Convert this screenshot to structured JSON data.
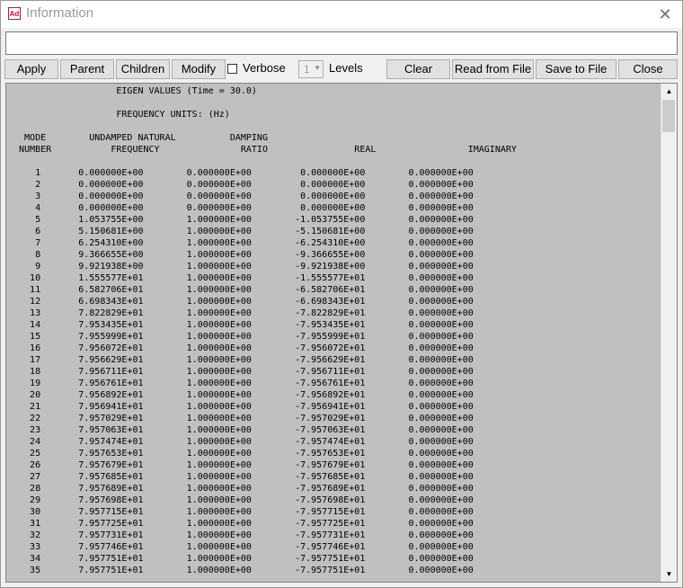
{
  "window": {
    "icon_label": "Ad",
    "title": "Information",
    "close_glyph": "✕"
  },
  "command": {
    "value": ""
  },
  "toolbar": {
    "apply": "Apply",
    "parent": "Parent",
    "children": "Children",
    "modify": "Modify",
    "verbose": "Verbose",
    "levels_value": "1",
    "levels": "Levels",
    "clear": "Clear",
    "read_from_file": "Read from File",
    "save_to_file": "Save to File",
    "close": "Close"
  },
  "output": {
    "header_lines": [
      "                   EIGEN VALUES (Time = 30.0)",
      "",
      "                   FREQUENCY UNITS: (Hz)",
      "",
      "  MODE        UNDAMPED NATURAL          DAMPING",
      " NUMBER           FREQUENCY               RATIO                REAL                 IMAGINARY",
      ""
    ],
    "rows": [
      [
        "1",
        "0.000000E+00",
        "0.000000E+00",
        "0.000000E+00",
        "0.000000E+00"
      ],
      [
        "2",
        "0.000000E+00",
        "0.000000E+00",
        "0.000000E+00",
        "0.000000E+00"
      ],
      [
        "3",
        "0.000000E+00",
        "0.000000E+00",
        "0.000000E+00",
        "0.000000E+00"
      ],
      [
        "4",
        "0.000000E+00",
        "0.000000E+00",
        "0.000000E+00",
        "0.000000E+00"
      ],
      [
        "5",
        "1.053755E+00",
        "1.000000E+00",
        "-1.053755E+00",
        "0.000000E+00"
      ],
      [
        "6",
        "5.150681E+00",
        "1.000000E+00",
        "-5.150681E+00",
        "0.000000E+00"
      ],
      [
        "7",
        "6.254310E+00",
        "1.000000E+00",
        "-6.254310E+00",
        "0.000000E+00"
      ],
      [
        "8",
        "9.366655E+00",
        "1.000000E+00",
        "-9.366655E+00",
        "0.000000E+00"
      ],
      [
        "9",
        "9.921938E+00",
        "1.000000E+00",
        "-9.921938E+00",
        "0.000000E+00"
      ],
      [
        "10",
        "1.555577E+01",
        "1.000000E+00",
        "-1.555577E+01",
        "0.000000E+00"
      ],
      [
        "11",
        "6.582706E+01",
        "1.000000E+00",
        "-6.582706E+01",
        "0.000000E+00"
      ],
      [
        "12",
        "6.698343E+01",
        "1.000000E+00",
        "-6.698343E+01",
        "0.000000E+00"
      ],
      [
        "13",
        "7.822829E+01",
        "1.000000E+00",
        "-7.822829E+01",
        "0.000000E+00"
      ],
      [
        "14",
        "7.953435E+01",
        "1.000000E+00",
        "-7.953435E+01",
        "0.000000E+00"
      ],
      [
        "15",
        "7.955999E+01",
        "1.000000E+00",
        "-7.955999E+01",
        "0.000000E+00"
      ],
      [
        "16",
        "7.956072E+01",
        "1.000000E+00",
        "-7.956072E+01",
        "0.000000E+00"
      ],
      [
        "17",
        "7.956629E+01",
        "1.000000E+00",
        "-7.956629E+01",
        "0.000000E+00"
      ],
      [
        "18",
        "7.956711E+01",
        "1.000000E+00",
        "-7.956711E+01",
        "0.000000E+00"
      ],
      [
        "19",
        "7.956761E+01",
        "1.000000E+00",
        "-7.956761E+01",
        "0.000000E+00"
      ],
      [
        "20",
        "7.956892E+01",
        "1.000000E+00",
        "-7.956892E+01",
        "0.000000E+00"
      ],
      [
        "21",
        "7.956941E+01",
        "1.000000E+00",
        "-7.956941E+01",
        "0.000000E+00"
      ],
      [
        "22",
        "7.957029E+01",
        "1.000000E+00",
        "-7.957029E+01",
        "0.000000E+00"
      ],
      [
        "23",
        "7.957063E+01",
        "1.000000E+00",
        "-7.957063E+01",
        "0.000000E+00"
      ],
      [
        "24",
        "7.957474E+01",
        "1.000000E+00",
        "-7.957474E+01",
        "0.000000E+00"
      ],
      [
        "25",
        "7.957653E+01",
        "1.000000E+00",
        "-7.957653E+01",
        "0.000000E+00"
      ],
      [
        "26",
        "7.957679E+01",
        "1.000000E+00",
        "-7.957679E+01",
        "0.000000E+00"
      ],
      [
        "27",
        "7.957685E+01",
        "1.000000E+00",
        "-7.957685E+01",
        "0.000000E+00"
      ],
      [
        "28",
        "7.957689E+01",
        "1.000000E+00",
        "-7.957689E+01",
        "0.000000E+00"
      ],
      [
        "29",
        "7.957698E+01",
        "1.000000E+00",
        "-7.957698E+01",
        "0.000000E+00"
      ],
      [
        "30",
        "7.957715E+01",
        "1.000000E+00",
        "-7.957715E+01",
        "0.000000E+00"
      ],
      [
        "31",
        "7.957725E+01",
        "1.000000E+00",
        "-7.957725E+01",
        "0.000000E+00"
      ],
      [
        "32",
        "7.957731E+01",
        "1.000000E+00",
        "-7.957731E+01",
        "0.000000E+00"
      ],
      [
        "33",
        "7.957746E+01",
        "1.000000E+00",
        "-7.957746E+01",
        "0.000000E+00"
      ],
      [
        "34",
        "7.957751E+01",
        "1.000000E+00",
        "-7.957751E+01",
        "0.000000E+00"
      ],
      [
        "35",
        "7.957751E+01",
        "1.000000E+00",
        "-7.957751E+01",
        "0.000000E+00"
      ]
    ]
  },
  "icons": {
    "scroll_up": "▲",
    "scroll_down": "▼",
    "dropdown": "▼"
  }
}
